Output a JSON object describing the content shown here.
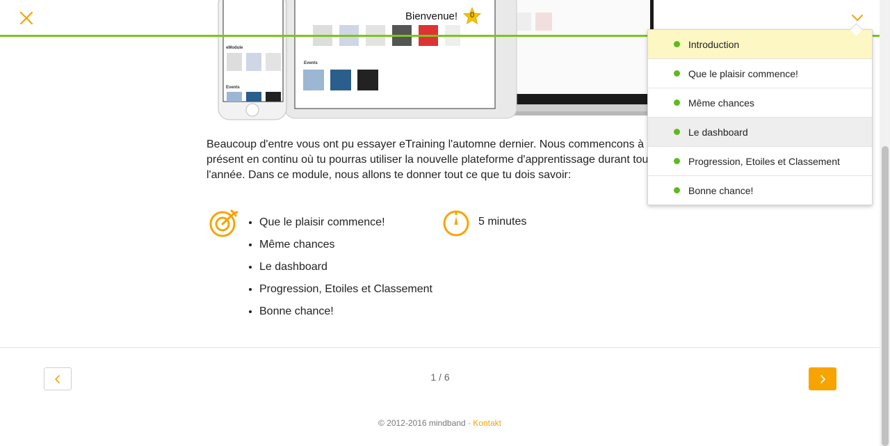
{
  "header": {
    "title": "Bienvenue!",
    "star_count": "0",
    "accent_color": "#f7a400",
    "progress_color": "#7dc420"
  },
  "chapter_menu": {
    "items": [
      {
        "label": "Introduction",
        "state": "active"
      },
      {
        "label": "Que le plaisir commence!",
        "state": "normal"
      },
      {
        "label": "Même chances",
        "state": "normal"
      },
      {
        "label": "Le dashboard",
        "state": "hover"
      },
      {
        "label": "Progression, Etoiles et Classement",
        "state": "normal"
      },
      {
        "label": "Bonne chance!",
        "state": "normal"
      }
    ]
  },
  "hero": {
    "phone_section_1": "eModule",
    "phone_section_2": "Events",
    "tablet_section": "Events"
  },
  "content": {
    "intro": "Beaucoup d'entre vous ont pu essayer eTraining l'automne dernier. Nous commencons à présent en continu où tu pourras utiliser la nouvelle plateforme d'apprentissage durant toute l'année. Dans ce module, nous allons te donner tout ce que tu dois savoir:",
    "goals": [
      "Que le plaisir commence!",
      "Même chances",
      "Le dashboard",
      "Progression, Etoiles et Classement",
      "Bonne chance!"
    ],
    "duration": "5 minutes"
  },
  "pager": {
    "indicator": "1 / 6"
  },
  "footer": {
    "copyright": "© 2012-2016 mindband",
    "separator": "·",
    "contact_link": "Kontakt"
  },
  "icons": {
    "close": "close-icon",
    "menu_toggle": "chevron-down-icon",
    "star": "star-icon",
    "goals": "target-icon",
    "duration": "stopwatch-icon",
    "prev": "chevron-left-icon",
    "next": "chevron-right-icon"
  }
}
